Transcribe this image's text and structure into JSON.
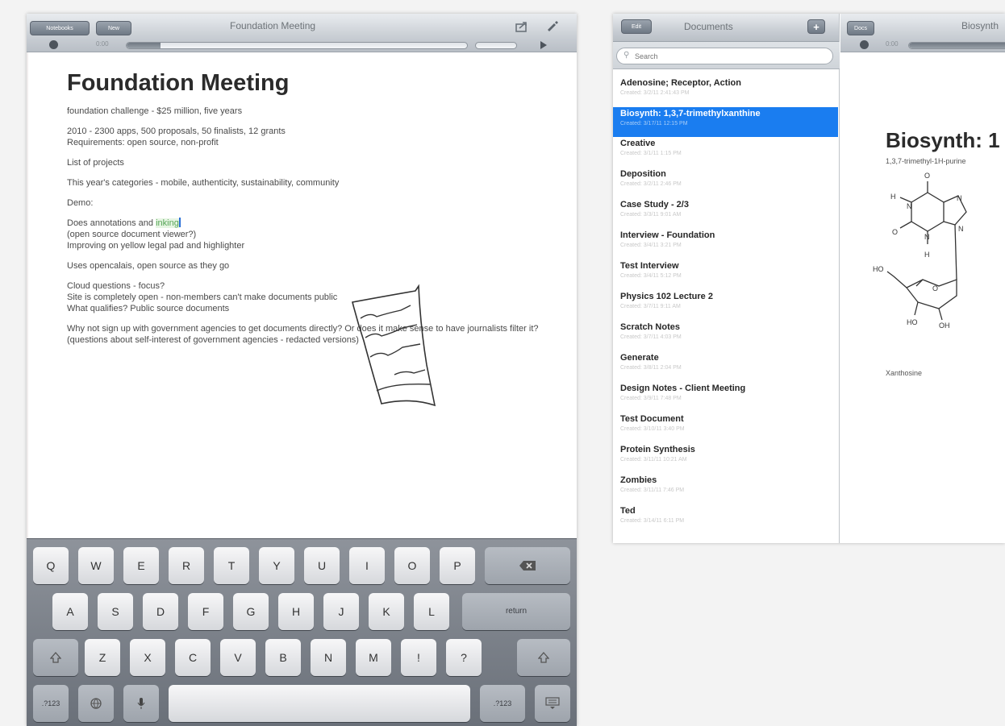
{
  "note": {
    "toolbar": {
      "left_button_1": "Notebooks",
      "left_button_2": "New",
      "title": "Foundation Meeting",
      "share_icon": "share-icon",
      "edit_icon": "pencil-icon",
      "time_label": "0:00",
      "progress": 0.1
    },
    "title": "Foundation Meeting",
    "paragraphs": [
      "foundation challenge - $25 million, five years",
      "2010 - 2300 apps, 500 proposals, 50 finalists, 12 grants\nRequirements: open source, non-profit",
      "List of projects",
      "This year's categories - mobile, authenticity, sustainability, community",
      "Demo:",
      "Does annotations and ",
      "Uses opencalais, open source as they go",
      "Cloud questions - focus?\nSite is completely open - non-members can't make documents public\nWhat qualifies? Public source documents",
      "Why not sign up with government agencies to get documents directly? Or does it make sense to have journalists filter it? (questions about self-interest of government agencies - redacted versions)"
    ],
    "highlighted_word": "inking",
    "annotation_lines": "(open source document viewer?)\nImproving on yellow legal pad and highlighter"
  },
  "keyboard": {
    "row1": [
      "Q",
      "W",
      "E",
      "R",
      "T",
      "Y",
      "U",
      "I",
      "O",
      "P"
    ],
    "row2": [
      "A",
      "S",
      "D",
      "F",
      "G",
      "H",
      "J",
      "K",
      "L"
    ],
    "row3": [
      "Z",
      "X",
      "C",
      "V",
      "B",
      "N",
      "M",
      "!",
      "?"
    ],
    "return_label": "return",
    "numbers_label": ".?123",
    "backspace_icon": "backspace-icon",
    "shift_icon": "shift-icon",
    "globe_icon": "globe-icon",
    "mic_icon": "microphone-icon",
    "dismiss_icon": "keyboard-dismiss-icon"
  },
  "documents": {
    "toolbar": {
      "edit_button": "Edit",
      "title": "Documents",
      "add_icon": "add-icon"
    },
    "search_placeholder": "Search",
    "items": [
      {
        "title": "Adenosine; Receptor, Action",
        "date": "Created: 3/2/11 2:41:43 PM"
      },
      {
        "title": "Biosynth: 1,3,7-trimethylxanthine",
        "date": "Created: 3/17/11 12:15 PM",
        "selected": true
      },
      {
        "title": "Creative",
        "date": "Created: 3/1/11 1:15 PM"
      },
      {
        "title": "Deposition",
        "date": "Created: 3/2/11 2:46 PM"
      },
      {
        "title": "Case Study - 2/3",
        "date": "Created: 3/3/11 9:01 AM"
      },
      {
        "title": "Interview - Foundation",
        "date": "Created: 3/4/11 3:21 PM"
      },
      {
        "title": "Test Interview",
        "date": "Created: 3/4/11 5:12 PM"
      },
      {
        "title": "Physics 102 Lecture 2",
        "date": "Created: 3/7/11 9:11 AM"
      },
      {
        "title": "Scratch Notes",
        "date": "Created: 3/7/11 4:03 PM"
      },
      {
        "title": "Generate",
        "date": "Created: 3/8/11 2:04 PM"
      },
      {
        "title": "Design Notes - Client Meeting",
        "date": "Created: 3/9/11 7:48 PM"
      },
      {
        "title": "Test Document",
        "date": "Created: 3/10/11 3:40 PM"
      },
      {
        "title": "Protein Synthesis",
        "date": "Created: 3/11/11 10:21 AM"
      },
      {
        "title": "Zombies",
        "date": "Created: 3/11/11 7:46 PM"
      },
      {
        "title": "Ted",
        "date": "Created: 3/14/11 6:11 PM"
      }
    ]
  },
  "detail": {
    "toolbar": {
      "back_button": "Docs",
      "title": "Biosynth",
      "time_label": "0:00"
    },
    "title": "Biosynth: 1",
    "subtitle": "1,3,7-trimethyl-1H-purine",
    "molecule_label": "Xanthosine",
    "atoms": {
      "o_top": "O",
      "h_left": "H",
      "n_left": "N",
      "o_left": "O",
      "n_bottom": "N",
      "h_bottom": "H",
      "ho_left": "HO",
      "o_ring": "O",
      "ho_bottom": "HO",
      "oh_bottom": "OH",
      "n_right": "N",
      "n_right2": "N"
    }
  },
  "colors": {
    "selection_blue": "#1a7df0",
    "highlight_green": "#57a558",
    "toolbar_gray": "#c9ced4"
  }
}
